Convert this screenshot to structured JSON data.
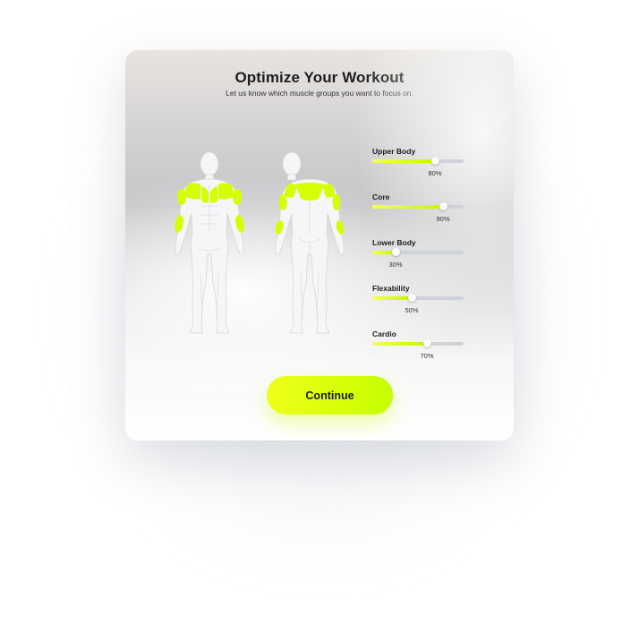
{
  "header": {
    "title": "Optimize Your Workout",
    "subtitle": "Let us know which muscle groups you want to focus on."
  },
  "figures": {
    "front_icon": "body-front-icon",
    "back_icon": "body-back-icon",
    "highlight_color": "#d4ff00"
  },
  "sliders": [
    {
      "label": "Upper Body",
      "value": 80,
      "display": "80%"
    },
    {
      "label": "Core",
      "value": 90,
      "display": "90%"
    },
    {
      "label": "Lower Body",
      "value": 30,
      "display": "30%"
    },
    {
      "label": "Flexability",
      "value": 50,
      "display": "50%"
    },
    {
      "label": "Cardio",
      "value": 70,
      "display": "70%"
    }
  ],
  "actions": {
    "continue_label": "Continue"
  },
  "colors": {
    "accent": "#d4ff00",
    "track": "#cfd3d8",
    "text": "#1d1d1f"
  }
}
